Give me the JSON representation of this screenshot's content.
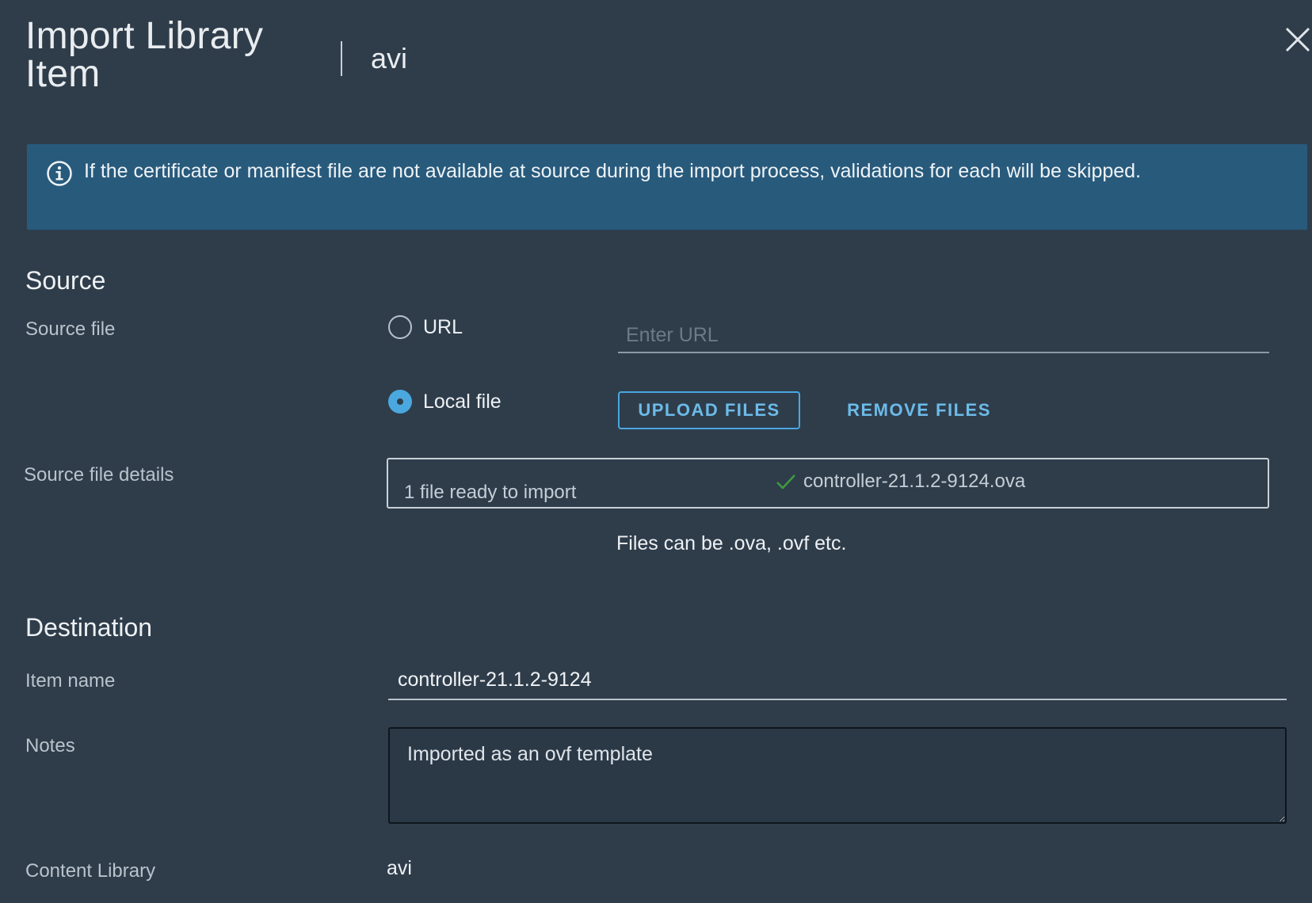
{
  "dialog": {
    "title": "Import Library Item",
    "subtitle": "avi",
    "close_icon": "close-icon"
  },
  "alert": {
    "icon": "info-icon",
    "text": "If the certificate or manifest file are not available at source during the import process, validations for each will be skipped."
  },
  "source": {
    "heading": "Source",
    "source_file_label": "Source file",
    "url_option_label": "URL",
    "url_placeholder": "Enter URL",
    "url_value": "",
    "local_option_label": "Local file",
    "selected_option": "Local file",
    "upload_button": "UPLOAD FILES",
    "remove_button": "REMOVE FILES",
    "details_label": "Source file details",
    "file_status": "1 file ready to import",
    "file_name": "controller-21.1.2-9124.ova",
    "file_check_icon": "checkmark-icon",
    "hint": "Files can be .ova, .ovf etc."
  },
  "destination": {
    "heading": "Destination",
    "item_name_label": "Item name",
    "item_name_value": "controller-21.1.2-9124",
    "notes_label": "Notes",
    "notes_value": "Imported as an ovf template",
    "content_library_label": "Content Library",
    "content_library_value": "avi"
  },
  "colors": {
    "background": "#2f3d4b",
    "alert_bg": "#285a7c",
    "accent": "#49a8e1",
    "check": "#3f9b3f"
  }
}
